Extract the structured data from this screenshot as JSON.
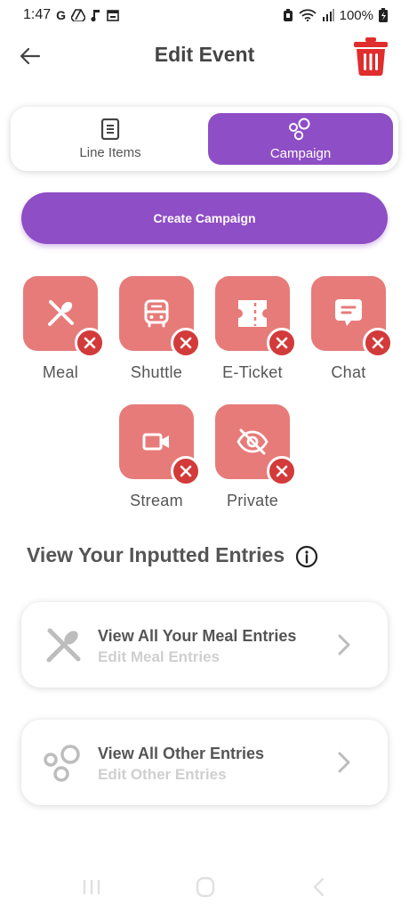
{
  "status_bar": {
    "time": "1:47",
    "g_glyph": "G",
    "battery": "100%"
  },
  "header": {
    "title": "Edit Event"
  },
  "tabs": [
    {
      "label": "Line Items",
      "icon": "document-icon",
      "active": false
    },
    {
      "label": "Campaign",
      "icon": "circles-icon",
      "active": true
    }
  ],
  "create_button": {
    "label": "Create Campaign"
  },
  "features": [
    {
      "label": "Meal",
      "icon": "utensils-icon"
    },
    {
      "label": "Shuttle",
      "icon": "bus-icon"
    },
    {
      "label": "E-Ticket",
      "icon": "ticket-icon"
    },
    {
      "label": "Chat",
      "icon": "chat-icon"
    },
    {
      "label": "Stream",
      "icon": "video-icon"
    },
    {
      "label": "Private",
      "icon": "eye-off-icon"
    }
  ],
  "section": {
    "title": "View Your Inputted Entries"
  },
  "entries": [
    {
      "title": "View All Your Meal Entries",
      "subtitle": "Edit Meal Entries",
      "icon": "utensils-icon"
    },
    {
      "title": "View All Other Entries",
      "subtitle": "Edit Other Entries",
      "icon": "circles-icon"
    }
  ],
  "colors": {
    "accent": "#8e4ec6",
    "tile": "#e77b79",
    "remove": "#d33a3a",
    "trash": "#e02d2d"
  }
}
